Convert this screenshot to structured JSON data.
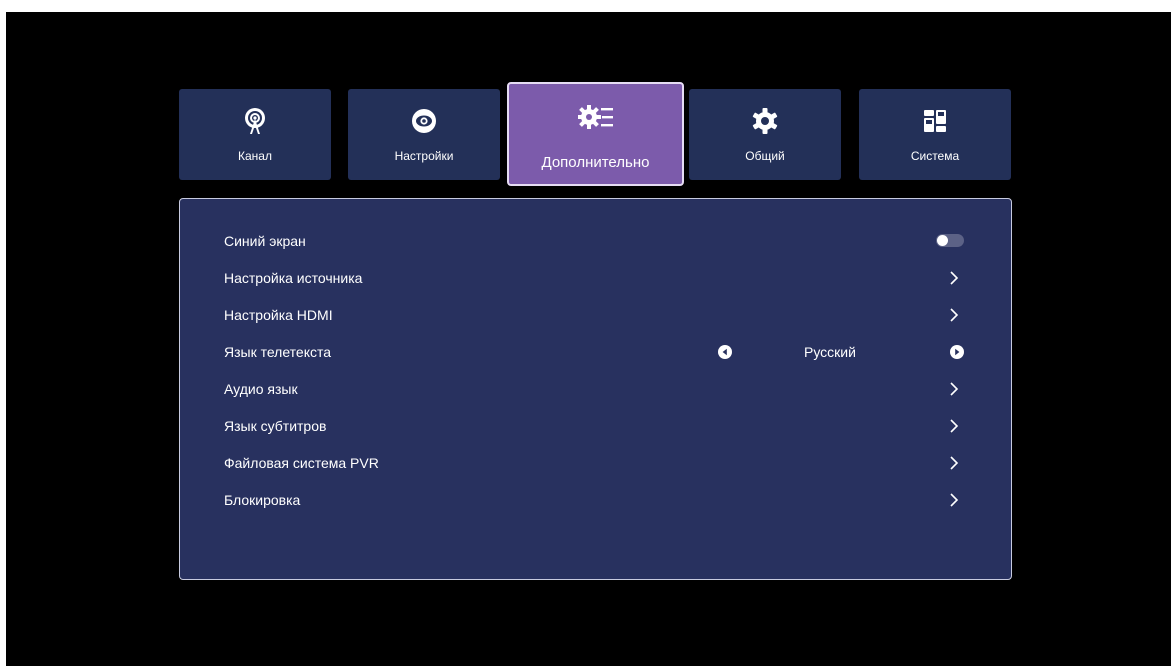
{
  "tabs": [
    {
      "label": "Канал",
      "icon": "antenna-icon"
    },
    {
      "label": "Настройки",
      "icon": "eye-icon"
    },
    {
      "label": "Дополнительно",
      "icon": "advanced-settings-icon",
      "active": true
    },
    {
      "label": "Общий",
      "icon": "gear-icon"
    },
    {
      "label": "Система",
      "icon": "system-grid-icon"
    }
  ],
  "menu": {
    "items": [
      {
        "label": "Синий экран",
        "control": "toggle",
        "value": "off"
      },
      {
        "label": "Настройка источника",
        "control": "chevron"
      },
      {
        "label": "Настройка HDMI",
        "control": "chevron"
      },
      {
        "label": "Язык телетекста",
        "control": "selector",
        "value": "Русский"
      },
      {
        "label": "Аудио язык",
        "control": "chevron"
      },
      {
        "label": "Язык субтитров",
        "control": "chevron"
      },
      {
        "label": "Файловая система PVR",
        "control": "chevron"
      },
      {
        "label": "Блокировка",
        "control": "chevron"
      }
    ]
  },
  "colors": {
    "background": "#000000",
    "tab": "#233058",
    "tab_active": "#7c5bab",
    "panel": "#28315f"
  }
}
